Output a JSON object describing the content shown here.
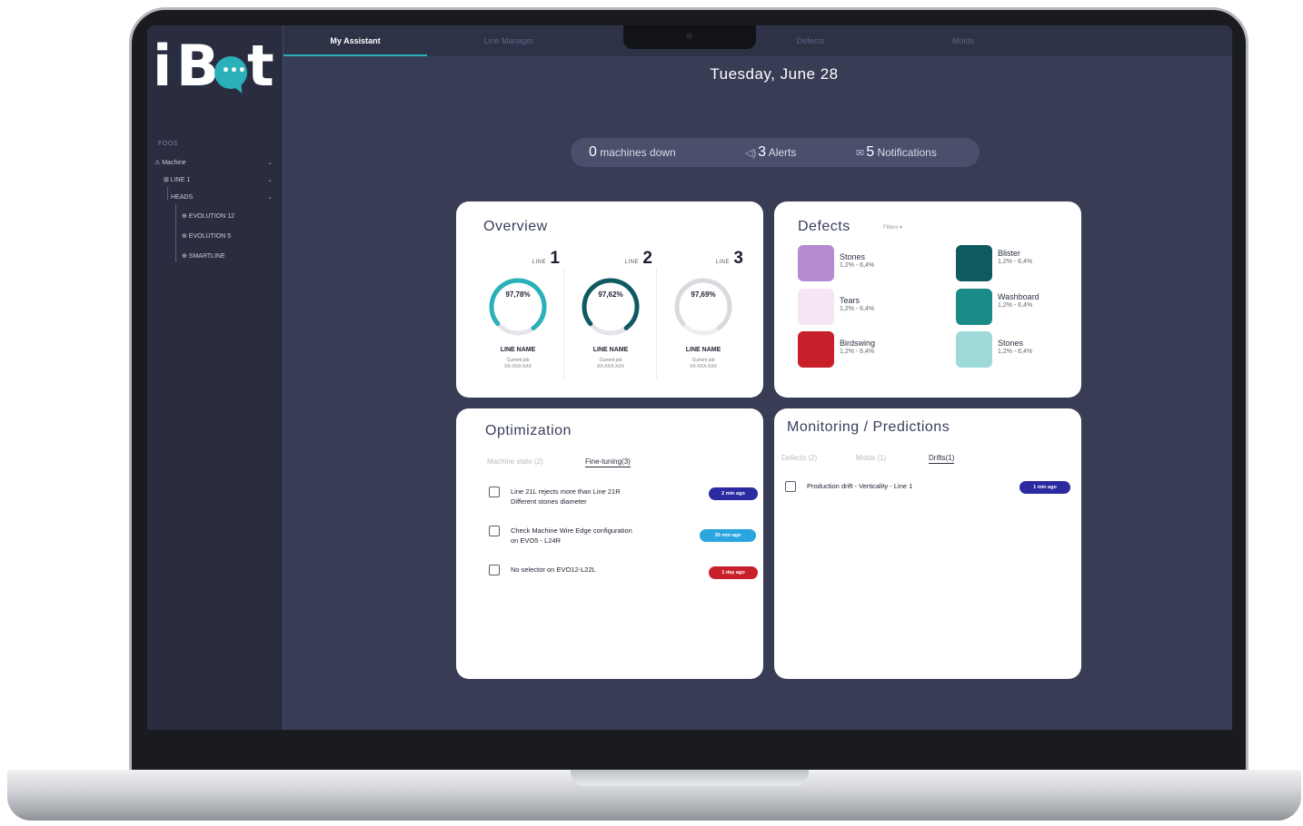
{
  "app": {
    "logo": "iBot"
  },
  "tabs": [
    {
      "label": "My Assistant",
      "active": true
    },
    {
      "label": "Line Manager",
      "active": false
    },
    {
      "label": "Defects",
      "active": false
    },
    {
      "label": "Molds",
      "active": false
    }
  ],
  "sidebar": {
    "caption": "FOOS",
    "items": [
      {
        "label": "⚠ Machine",
        "level": 0
      },
      {
        "label": "⊞ LINE 1",
        "level": 1
      },
      {
        "label": "HEADS",
        "level": 2
      },
      {
        "label": "⊕ EVOLUTION 12",
        "level": 3
      },
      {
        "label": "⊕ EVOLUTION 5",
        "level": 3
      },
      {
        "label": "⊕ SMARTLINE",
        "level": 3
      }
    ]
  },
  "header": {
    "date": "Tuesday, June 28"
  },
  "status": {
    "machines_down_count": "0",
    "machines_down_label": "machines down",
    "alerts_count": "3",
    "alerts_label": "Alerts",
    "notifications_count": "5",
    "notifications_label": "Notifications"
  },
  "overview": {
    "title": "Overview",
    "line_prefix": "LINE",
    "lines": [
      {
        "number": "1",
        "percent": "97,78%",
        "value": 97.78,
        "name": "LINE NAME",
        "sub1": "Current job",
        "sub2": "XX-XXX-XXX",
        "color": "#2ab0b8"
      },
      {
        "number": "2",
        "percent": "97,62%",
        "value": 97.62,
        "name": "LINE NAME",
        "sub1": "Current job",
        "sub2": "XX-XXX-XXX",
        "color": "#0f5a61"
      },
      {
        "number": "3",
        "percent": "97,69%",
        "value": 97.69,
        "name": "LINE NAME",
        "sub1": "Current job",
        "sub2": "XX-XXX-XXX",
        "color": "#d9dadf"
      }
    ]
  },
  "defects": {
    "title": "Defects",
    "filter": "Filters ▾",
    "items": [
      {
        "name": "Stones",
        "range": "1,2% - 6,4%",
        "color": "#b58ad0"
      },
      {
        "name": "Blister",
        "range": "1,2% - 6,4%",
        "color": "#0f5a61"
      },
      {
        "name": "Tears",
        "range": "1,2% - 6,4%",
        "color": "#f6e6f3"
      },
      {
        "name": "Washboard",
        "range": "1,2% - 6,4%",
        "color": "#1a8b86"
      },
      {
        "name": "Birdswing",
        "range": "1,2% - 6,4%",
        "color": "#c81f2a"
      },
      {
        "name": "Stones",
        "range": "1,2% - 6,4%",
        "color": "#9fdada"
      }
    ]
  },
  "optimization": {
    "title": "Optimization",
    "subtabs": [
      {
        "label": "Machine state (2)",
        "active": false
      },
      {
        "label": "Fine-tuning(3)",
        "active": true
      }
    ],
    "tasks": [
      {
        "line1": "Line 21L rejects more than Line 21R",
        "line2": "Different stones diameter",
        "badge": "2 min ago",
        "badge_color": "#2b2aa0"
      },
      {
        "line1": "Check Machine Wire Edge configuration",
        "line2": "on EVO5 - L24R",
        "badge": "30 min ago",
        "badge_color": "#2aa5e0"
      },
      {
        "line1": "No selector on EVO12-L22L",
        "line2": "",
        "badge": "1 day ago",
        "badge_color": "#c81f2a"
      }
    ]
  },
  "monitoring": {
    "title": "Monitoring / Predictions",
    "subtabs": [
      {
        "label": "Defects (2)",
        "active": false
      },
      {
        "label": "Molds (1)",
        "active": false
      },
      {
        "label": "Drifts(1)",
        "active": true
      }
    ],
    "tasks": [
      {
        "text": "Production drift - Verticality - Line 1",
        "badge": "1 min ago",
        "badge_color": "#2b2aa0"
      }
    ]
  }
}
